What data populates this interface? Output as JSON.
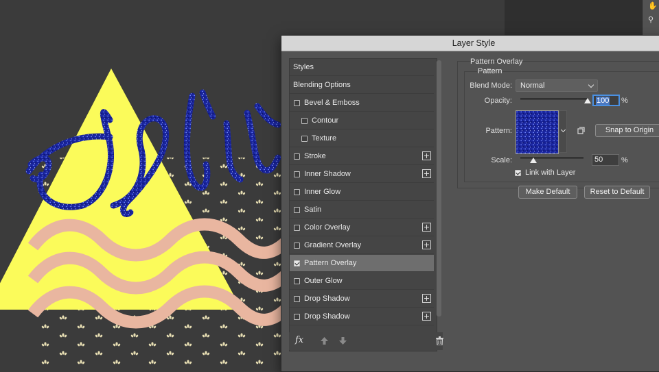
{
  "dialog": {
    "title": "Layer Style"
  },
  "styles_list": [
    {
      "label": "Styles",
      "type": "header"
    },
    {
      "label": "Blending Options",
      "type": "header"
    },
    {
      "label": "Bevel & Emboss",
      "checked": false
    },
    {
      "label": "Contour",
      "checked": false,
      "indent": true
    },
    {
      "label": "Texture",
      "checked": false,
      "indent": true
    },
    {
      "label": "Stroke",
      "checked": false,
      "plus": true
    },
    {
      "label": "Inner Shadow",
      "checked": false,
      "plus": true
    },
    {
      "label": "Inner Glow",
      "checked": false
    },
    {
      "label": "Satin",
      "checked": false
    },
    {
      "label": "Color Overlay",
      "checked": false,
      "plus": true
    },
    {
      "label": "Gradient Overlay",
      "checked": false,
      "plus": true
    },
    {
      "label": "Pattern Overlay",
      "checked": true,
      "selected": true
    },
    {
      "label": "Outer Glow",
      "checked": false
    },
    {
      "label": "Drop Shadow",
      "checked": false,
      "plus": true
    },
    {
      "label": "Drop Shadow",
      "checked": false,
      "plus": true
    }
  ],
  "bottom_bar": {
    "fx_label": "fx"
  },
  "pattern_overlay": {
    "section_title": "Pattern Overlay",
    "group_title": "Pattern",
    "blend_mode_label": "Blend Mode:",
    "blend_mode_value": "Normal",
    "opacity_label": "Opacity:",
    "opacity_value": "100",
    "opacity_level": 1.0,
    "percent": "%",
    "pattern_label": "Pattern:",
    "snap_button": "Snap to Origin",
    "scale_label": "Scale:",
    "scale_value": "50",
    "scale_level": 0.21,
    "link_label": "Link with Layer",
    "link_checked": true,
    "make_default_button": "Make Default",
    "reset_default_button": "Reset to Default"
  },
  "colors": {
    "canvas_bg": "#3b3b3b",
    "triangle": "#fbfb5a",
    "waves": "#e9b6a0",
    "glitter": "#1c2bb0",
    "dots": "#e6ddb2",
    "dialog_bg": "#535353"
  },
  "icons": [
    "fx-icon",
    "move-up-icon",
    "move-down-icon",
    "trash-icon",
    "add-effect-icon",
    "new-preset-icon",
    "chevron-down-icon",
    "checkbox-icon"
  ]
}
